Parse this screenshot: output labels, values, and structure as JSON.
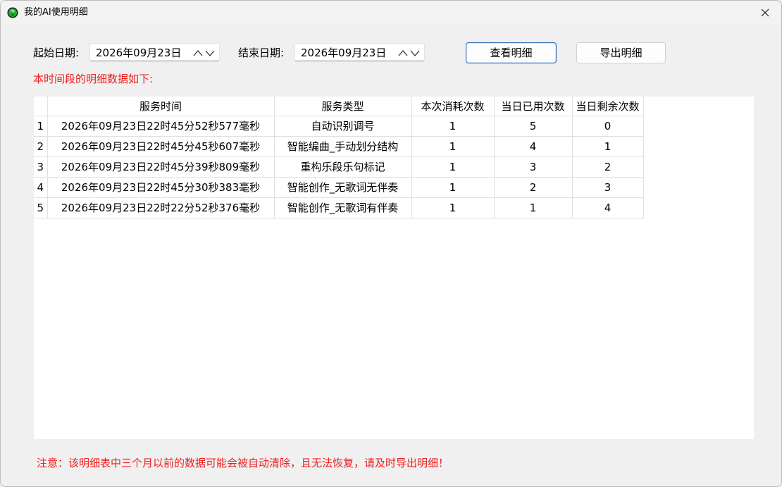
{
  "window": {
    "title": "我的AI使用明细"
  },
  "filters": {
    "start_label": "起始日期:",
    "start_value": "2026年09月23日",
    "end_label": "结束日期:",
    "end_value": "2026年09月23日",
    "view_button": "查看明细",
    "export_button": "导出明细"
  },
  "caption": "本时间段的明细数据如下:",
  "table": {
    "columns": [
      "服务时间",
      "服务类型",
      "本次消耗次数",
      "当日已用次数",
      "当日剩余次数"
    ],
    "rows": [
      {
        "index": "1",
        "time": "2026年09月23日22时45分52秒577毫秒",
        "type": "自动识别调号",
        "cost": "1",
        "used": "5",
        "remain": "0"
      },
      {
        "index": "2",
        "time": "2026年09月23日22时45分45秒607毫秒",
        "type": "智能编曲_手动划分结构",
        "cost": "1",
        "used": "4",
        "remain": "1"
      },
      {
        "index": "3",
        "time": "2026年09月23日22时45分39秒809毫秒",
        "type": "重构乐段乐句标记",
        "cost": "1",
        "used": "3",
        "remain": "2"
      },
      {
        "index": "4",
        "time": "2026年09月23日22时45分30秒383毫秒",
        "type": "智能创作_无歌词无伴奏",
        "cost": "1",
        "used": "2",
        "remain": "3"
      },
      {
        "index": "5",
        "time": "2026年09月23日22时22分52秒376毫秒",
        "type": "智能创作_无歌词有伴奏",
        "cost": "1",
        "used": "1",
        "remain": "4"
      }
    ]
  },
  "footer_note": "注意：该明细表中三个月以前的数据可能会被自动清除，且无法恢复，请及时导出明细！",
  "colors": {
    "warning_red": "#f01d1d",
    "primary_border": "#2f6fb3"
  },
  "icons": {
    "app": "globe-app-icon",
    "close": "close-icon",
    "spin_up": "chevron-up-icon",
    "spin_down": "chevron-down-icon"
  }
}
